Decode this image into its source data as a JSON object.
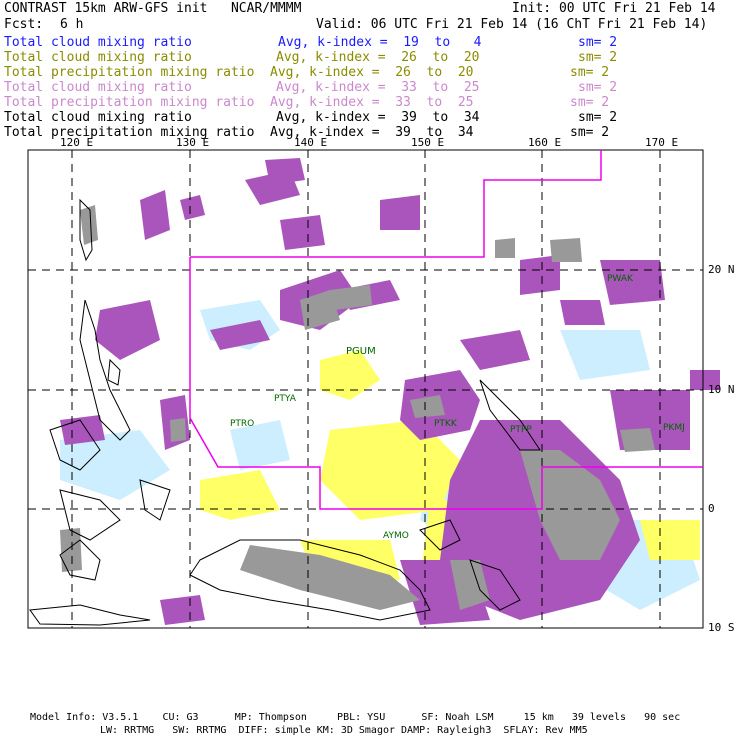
{
  "header": {
    "title": "CONTRAST 15km ARW-GFS init   NCAR/MMMM",
    "init": "Init: 00 UTC Fri 21 Feb 14",
    "fcst_label": "Fcst:",
    "fcst_value": "6 h",
    "valid": "Valid: 06 UTC Fri 21 Feb 14 (16 ChT Fri 21 Feb 14)"
  },
  "legend": [
    {
      "field": "Total cloud mixing ratio",
      "range": "Avg, k-index =  19  to   4",
      "smooth": "sm= 2",
      "color": "#1a1aff"
    },
    {
      "field": "Total cloud mixing ratio",
      "range": "Avg, k-index =  26  to  20",
      "smooth": "sm= 2",
      "color": "#8c8c00"
    },
    {
      "field": "Total precipitation mixing ratio",
      "range": "Avg, k-index =  26  to  20",
      "smooth": "sm= 2",
      "color": "#8c8c00"
    },
    {
      "field": "Total cloud mixing ratio",
      "range": "Avg, k-index =  33  to  25",
      "smooth": "sm= 2",
      "color": "#cc88cc"
    },
    {
      "field": "Total precipitation mixing ratio",
      "range": "Avg, k-index =  33  to  25",
      "smooth": "sm= 2",
      "color": "#cc88cc"
    },
    {
      "field": "Total cloud mixing ratio",
      "range": "Avg, k-index =  39  to  34",
      "smooth": "sm= 2",
      "color": "#000000"
    },
    {
      "field": "Total precipitation mixing ratio",
      "range": "Avg, k-index =  39  to  34",
      "smooth": "sm= 2",
      "color": "#000000"
    }
  ],
  "map": {
    "lon_labels": [
      "120 E",
      "130 E",
      "140 E",
      "150 E",
      "160 E",
      "170 E"
    ],
    "lat_labels": [
      "20 N",
      "10 N",
      "0",
      "10 S"
    ],
    "stations": [
      "PWAK",
      "PGUM",
      "PTYA",
      "PTRO",
      "PTKK",
      "PTPP",
      "PKMJ",
      "AYMO"
    ],
    "colors": {
      "light_cloud": "#cceeff",
      "mid_cloud": "#ffff66",
      "high_cloud": "#aa55bb",
      "precip_core": "#999999",
      "boundary": "#ee00ee"
    }
  },
  "footer": {
    "line1": "Model Info: V3.5.1    CU: G3      MP: Thompson     PBL: YSU      SF: Noah LSM     15 km   39 levels   90 sec",
    "line2": "LW: RRTMG   SW: RRTMG  DIFF: simple KM: 3D Smagor DAMP: Rayleigh3  SFLAY: Rev MM5"
  }
}
